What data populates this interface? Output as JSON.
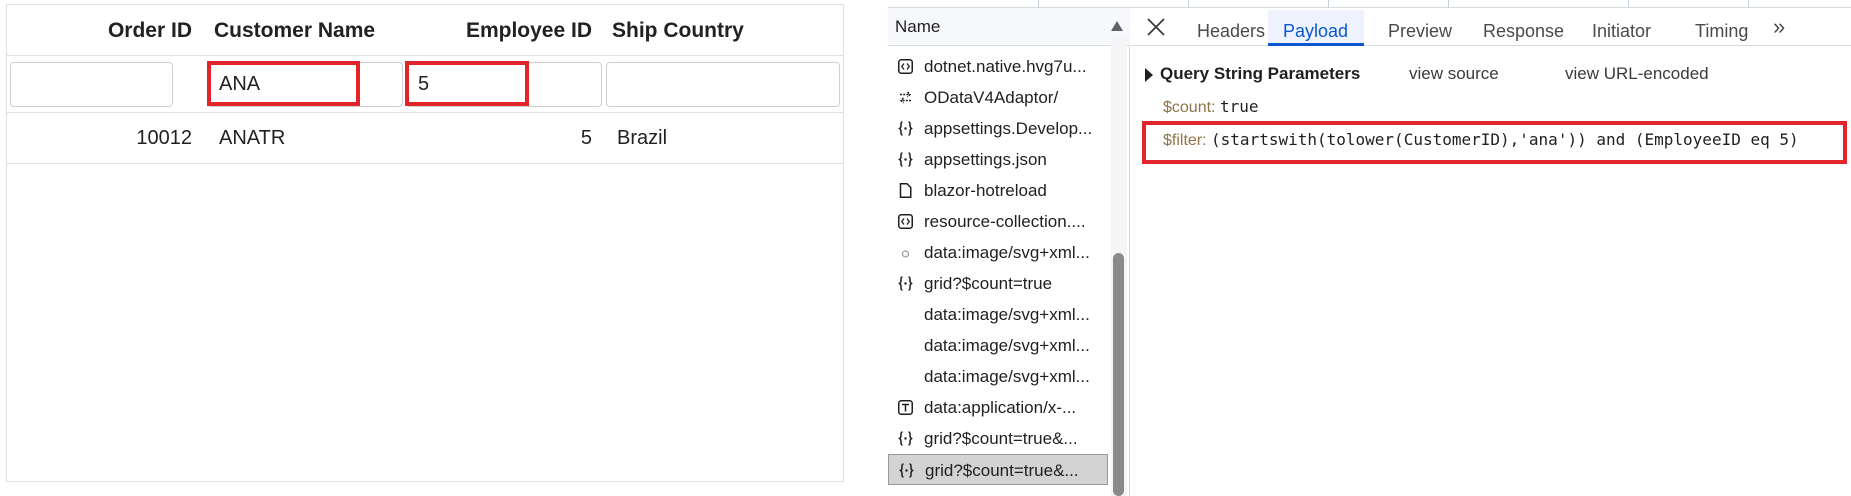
{
  "grid": {
    "columns": [
      "Order ID",
      "Customer Name",
      "Employee ID",
      "Ship Country"
    ],
    "filters": {
      "order_id": "",
      "customer_name": "ANA",
      "employee_id": "5",
      "ship_country": ""
    },
    "rows": [
      {
        "order_id": "10012",
        "customer_name": "ANATR",
        "employee_id": "5",
        "ship_country": "Brazil"
      }
    ]
  },
  "devtools": {
    "name_column": "Name",
    "requests": [
      {
        "label": "dotnet.native.hvg7u...",
        "icon": "script-icon"
      },
      {
        "label": "ODataV4Adaptor/",
        "icon": "fetch-icon"
      },
      {
        "label": "appsettings.Develop...",
        "icon": "json-icon"
      },
      {
        "label": "appsettings.json",
        "icon": "json-icon"
      },
      {
        "label": "blazor-hotreload",
        "icon": "document-icon"
      },
      {
        "label": "resource-collection....",
        "icon": "script-icon"
      },
      {
        "label": "data:image/svg+xml...",
        "icon": "image-icon"
      },
      {
        "label": "grid?$count=true",
        "icon": "json-icon"
      },
      {
        "label": "data:image/svg+xml...",
        "icon": "none"
      },
      {
        "label": "data:image/svg+xml...",
        "icon": "none"
      },
      {
        "label": "data:image/svg+xml...",
        "icon": "none"
      },
      {
        "label": "data:application/x-...",
        "icon": "font-icon"
      },
      {
        "label": "grid?$count=true&...",
        "icon": "json-icon"
      },
      {
        "label": "grid?$count=true&...",
        "icon": "json-icon",
        "selected": true
      }
    ],
    "tabs": [
      "Headers",
      "Payload",
      "Preview",
      "Response",
      "Initiator",
      "Timing"
    ],
    "active_tab": "Payload",
    "payload": {
      "section_title": "Query String Parameters",
      "view_source": "view source",
      "view_url_encoded": "view URL-encoded",
      "params": [
        {
          "key": "$count:",
          "value": "true"
        },
        {
          "key": "$filter:",
          "value": "(startswith(tolower(CustomerID),'ana')) and (EmployeeID eq 5)"
        }
      ]
    },
    "colors": {
      "accent": "#0b57d0",
      "highlight": "#e3242b"
    }
  }
}
